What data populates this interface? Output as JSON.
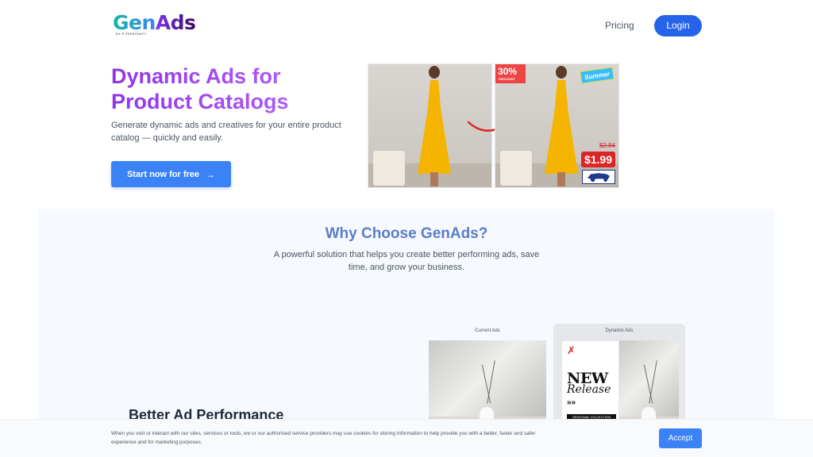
{
  "header": {
    "logo_gen": "Gen",
    "logo_ads": "Ads",
    "logo_sub": "BY ✗ PERSONAFY",
    "nav_pricing": "Pricing",
    "login_label": "Login"
  },
  "hero": {
    "title": "Dynamic Ads for Product Catalogs",
    "description": "Generate dynamic ads and creatives for your entire product catalog — quickly and easily.",
    "cta_label": "Start now for free",
    "cta_arrow": "→",
    "badge_percent": "30%",
    "badge_sub": "DISCOUNT",
    "badge_summer": "Summer",
    "price_old": "$2.84",
    "price_new": "$1.99"
  },
  "why": {
    "title": "Why Choose GenAds?",
    "description": "A powerful solution that helps you create better performing ads, save time, and grow your business.",
    "feature_title": "Better Ad Performance",
    "label_current": "Current Ads",
    "label_dynamic": "Dynamic Ads",
    "poster_logo": "✗",
    "poster_new": "NEW",
    "poster_release": "Release",
    "poster_chevrons": "»»",
    "poster_band": "SEASONAL COLLECTION"
  },
  "cookie": {
    "text": "When you visit or interact with our sites, services or tools, we or our authorised service providers may use cookies for storing information to help provide you with a better, faster and safer experience and for marketing purposes.",
    "accept_label": "Accept"
  },
  "colors": {
    "primary": "#3b82f6",
    "login": "#2563eb",
    "hero_gradient": "#9333ea",
    "why_title": "#5b7dc9",
    "section_bg": "#f6f9fe"
  }
}
